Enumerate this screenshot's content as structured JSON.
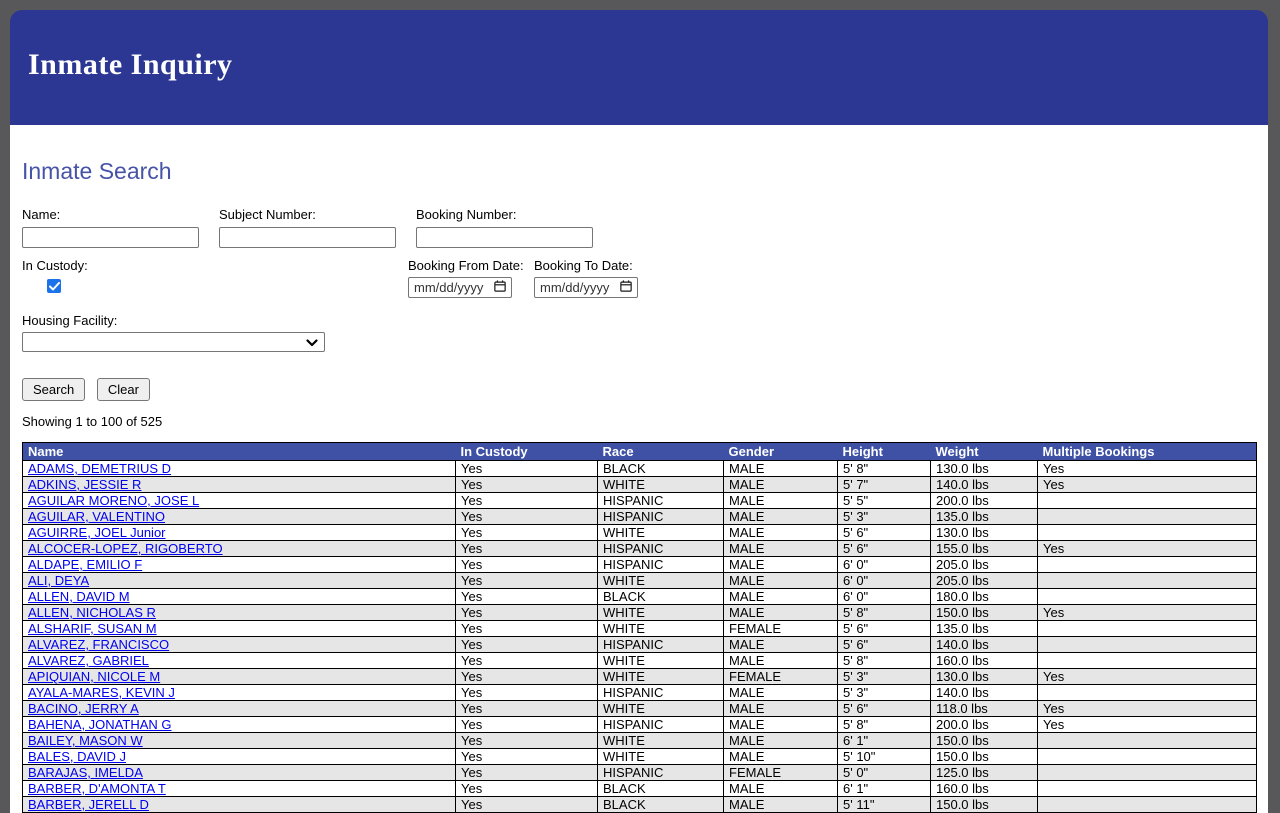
{
  "header": {
    "title": "Inmate Inquiry"
  },
  "search": {
    "heading": "Inmate Search",
    "fields": {
      "name_label": "Name:",
      "name_value": "",
      "subject_label": "Subject Number:",
      "subject_value": "",
      "booking_label": "Booking Number:",
      "booking_value": "",
      "custody_label": "In Custody:",
      "custody_checked": true,
      "from_label": "Booking From Date:",
      "to_label": "Booking To Date:",
      "date_placeholder": "mm/dd/yyyy",
      "housing_label": "Housing Facility:",
      "housing_value": ""
    },
    "buttons": {
      "search": "Search",
      "clear": "Clear"
    },
    "results_summary": "Showing 1 to 100 of 525"
  },
  "icons": {
    "checkmark": "check-icon",
    "calendar": "calendar-icon",
    "chevron": "chevron-down-icon"
  },
  "colors": {
    "banner_bg": "#2B3792",
    "table_header_bg": "#3E51A5",
    "row_stripe": "#E6E6E6",
    "link": "#0000EE",
    "checkbox_blue": "#1A73E8",
    "frame_gray": "#58585A"
  },
  "table": {
    "columns": [
      "Name",
      "In Custody",
      "Race",
      "Gender",
      "Height",
      "Weight",
      "Multiple Bookings"
    ],
    "rows": [
      [
        "ADAMS, DEMETRIUS D",
        "Yes",
        "BLACK",
        "MALE",
        "5' 8\"",
        "130.0 lbs",
        "Yes"
      ],
      [
        "ADKINS, JESSIE R",
        "Yes",
        "WHITE",
        "MALE",
        "5' 7\"",
        "140.0 lbs",
        "Yes"
      ],
      [
        "AGUILAR MORENO, JOSE L",
        "Yes",
        "HISPANIC",
        "MALE",
        "5' 5\"",
        "200.0 lbs",
        ""
      ],
      [
        "AGUILAR, VALENTINO",
        "Yes",
        "HISPANIC",
        "MALE",
        "5' 3\"",
        "135.0 lbs",
        ""
      ],
      [
        "AGUIRRE, JOEL Junior",
        "Yes",
        "WHITE",
        "MALE",
        "5' 6\"",
        "130.0 lbs",
        ""
      ],
      [
        "ALCOCER-LOPEZ, RIGOBERTO",
        "Yes",
        "HISPANIC",
        "MALE",
        "5' 6\"",
        "155.0 lbs",
        "Yes"
      ],
      [
        "ALDAPE, EMILIO F",
        "Yes",
        "HISPANIC",
        "MALE",
        "6' 0\"",
        "205.0 lbs",
        ""
      ],
      [
        "ALI, DEYA",
        "Yes",
        "WHITE",
        "MALE",
        "6' 0\"",
        "205.0 lbs",
        ""
      ],
      [
        "ALLEN, DAVID M",
        "Yes",
        "BLACK",
        "MALE",
        "6' 0\"",
        "180.0 lbs",
        ""
      ],
      [
        "ALLEN, NICHOLAS R",
        "Yes",
        "WHITE",
        "MALE",
        "5' 8\"",
        "150.0 lbs",
        "Yes"
      ],
      [
        "ALSHARIF, SUSAN M",
        "Yes",
        "WHITE",
        "FEMALE",
        "5' 6\"",
        "135.0 lbs",
        ""
      ],
      [
        "ALVAREZ, FRANCISCO",
        "Yes",
        "HISPANIC",
        "MALE",
        "5' 6\"",
        "140.0 lbs",
        ""
      ],
      [
        "ALVAREZ, GABRIEL",
        "Yes",
        "WHITE",
        "MALE",
        "5' 8\"",
        "160.0 lbs",
        ""
      ],
      [
        "APIQUIAN, NICOLE M",
        "Yes",
        "WHITE",
        "FEMALE",
        "5' 3\"",
        "130.0 lbs",
        "Yes"
      ],
      [
        "AYALA-MARES, KEVIN J",
        "Yes",
        "HISPANIC",
        "MALE",
        "5' 3\"",
        "140.0 lbs",
        ""
      ],
      [
        "BACINO, JERRY A",
        "Yes",
        "WHITE",
        "MALE",
        "5' 6\"",
        "118.0 lbs",
        "Yes"
      ],
      [
        "BAHENA, JONATHAN G",
        "Yes",
        "HISPANIC",
        "MALE",
        "5' 8\"",
        "200.0 lbs",
        "Yes"
      ],
      [
        "BAILEY, MASON W",
        "Yes",
        "WHITE",
        "MALE",
        "6' 1\"",
        "150.0 lbs",
        ""
      ],
      [
        "BALES, DAVID J",
        "Yes",
        "WHITE",
        "MALE",
        "5' 10\"",
        "150.0 lbs",
        ""
      ],
      [
        "BARAJAS, IMELDA",
        "Yes",
        "HISPANIC",
        "FEMALE",
        "5' 0\"",
        "125.0 lbs",
        ""
      ],
      [
        "BARBER, D'AMONTA T",
        "Yes",
        "BLACK",
        "MALE",
        "6' 1\"",
        "160.0 lbs",
        ""
      ],
      [
        "BARBER, JERELL D",
        "Yes",
        "BLACK",
        "MALE",
        "5' 11\"",
        "150.0 lbs",
        ""
      ]
    ]
  }
}
